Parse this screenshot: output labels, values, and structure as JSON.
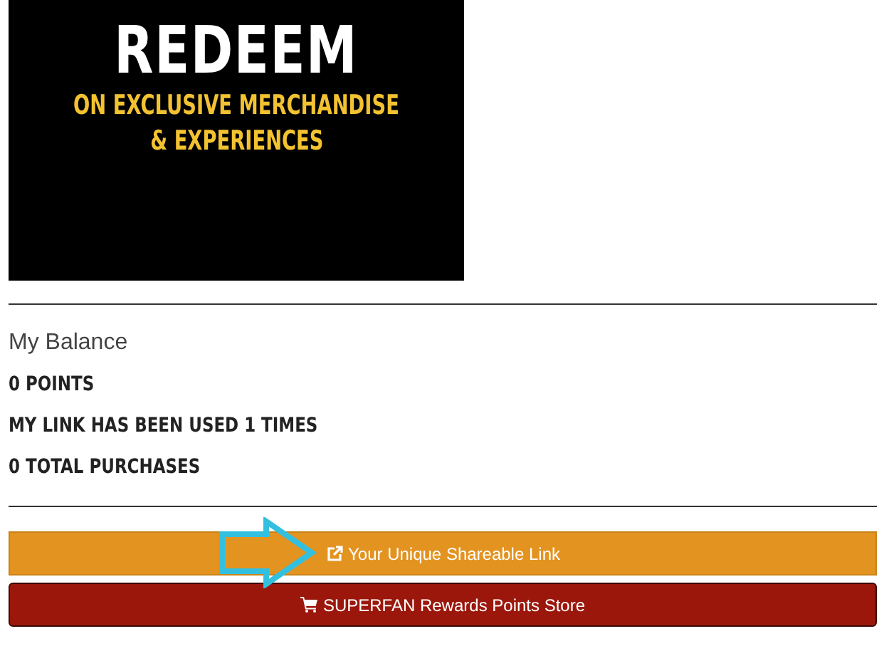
{
  "banner": {
    "title": "REDEEM",
    "subtitle_lines": [
      "ON EXCLUSIVE MERCHANDISE",
      "& EXPERIENCES"
    ]
  },
  "balance": {
    "label": "My Balance",
    "stats": [
      "0 POINTS",
      "MY LINK HAS BEEN USED 1 TIMES",
      "0 TOTAL PURCHASES"
    ]
  },
  "buttons": [
    {
      "kind": "share",
      "label": "Your Unique Shareable Link"
    },
    {
      "kind": "store",
      "label": "SUPERFAN Rewards Points Store"
    }
  ]
}
